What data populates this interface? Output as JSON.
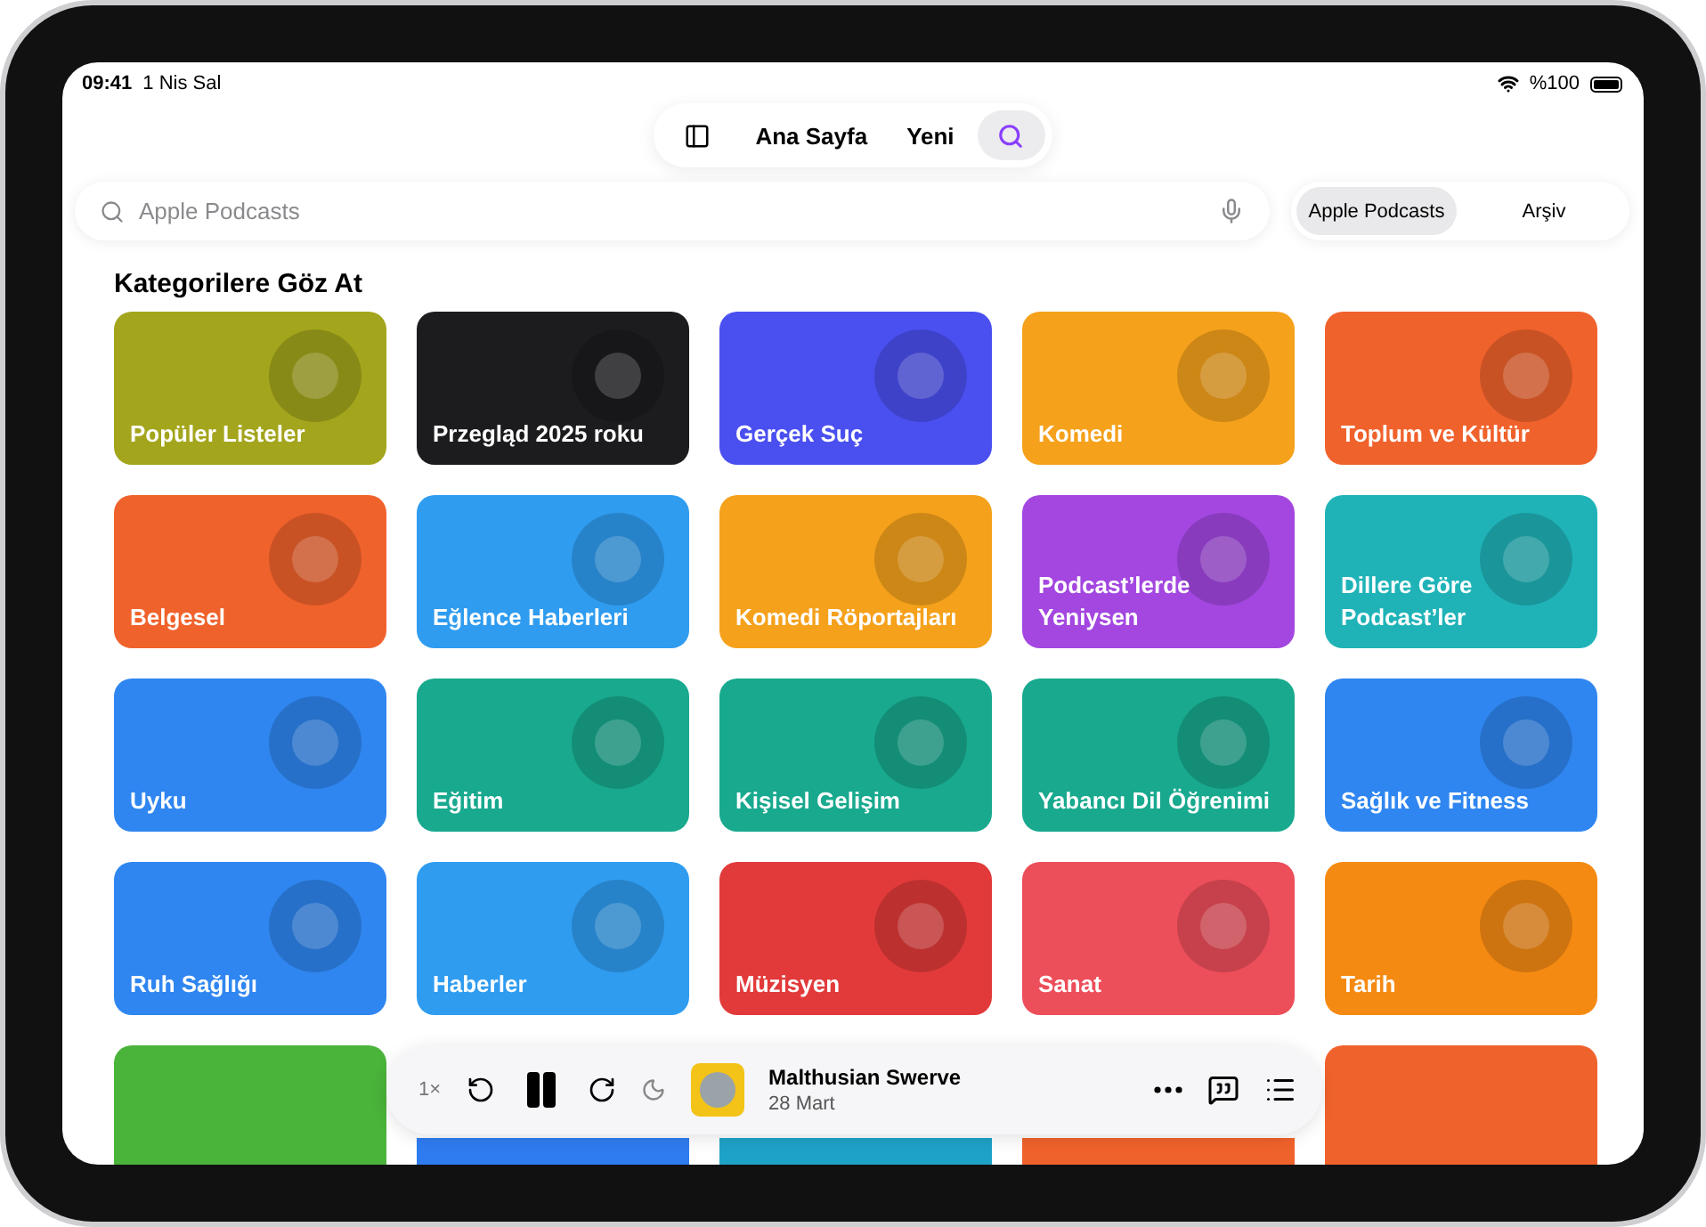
{
  "status_bar": {
    "time": "09:41",
    "date": "1 Nis Sal",
    "battery": "%100"
  },
  "nav": {
    "tabs": [
      {
        "label": "Ana Sayfa",
        "selected": false
      },
      {
        "label": "Yeni",
        "selected": false
      }
    ],
    "search_selected": true
  },
  "search": {
    "placeholder": "Apple Podcasts"
  },
  "scopes": [
    {
      "label": "Apple Podcasts",
      "selected": true
    },
    {
      "label": "Arşiv",
      "selected": false
    }
  ],
  "section_title": "Kategorilere Göz At",
  "categories": [
    {
      "label": "Popüler Listeler",
      "color": "#a3a51c"
    },
    {
      "label": "Przegląd 2025 roku",
      "color": "#1c1c1e"
    },
    {
      "label": "Gerçek Suç",
      "color": "#4a4ff0"
    },
    {
      "label": "Komedi",
      "color": "#f5a11b"
    },
    {
      "label": "Toplum ve Kültür",
      "color": "#f0622c"
    },
    {
      "label": "Belgesel",
      "color": "#f0622c"
    },
    {
      "label": "Eğlence Haberleri",
      "color": "#2f9cf0"
    },
    {
      "label": "Komedi Röportajları",
      "color": "#f5a11b"
    },
    {
      "label": "Podcast’lerde Yeniysen",
      "color": "#a347e0"
    },
    {
      "label": "Dillere Göre Podcast’ler",
      "color": "#1fb3b8"
    },
    {
      "label": "Uyku",
      "color": "#2f86f0"
    },
    {
      "label": "Eğitim",
      "color": "#18a98e"
    },
    {
      "label": "Kişisel Gelişim",
      "color": "#18a98e"
    },
    {
      "label": "Yabancı Dil Öğrenimi",
      "color": "#18a98e"
    },
    {
      "label": "Sağlık ve Fitness",
      "color": "#2f86f0"
    },
    {
      "label": "Ruh Sağlığı",
      "color": "#2f86f0"
    },
    {
      "label": "Haberler",
      "color": "#2f9cf0"
    },
    {
      "label": "Müzisyen",
      "color": "#e23a3a"
    },
    {
      "label": "Sanat",
      "color": "#ec4e5a"
    },
    {
      "label": "Tarih",
      "color": "#f58a12"
    },
    {
      "color": "#4ab33a"
    },
    {
      "color": "#2f7cf0"
    },
    {
      "color": "#1fa2c8"
    },
    {
      "color": "#f0622c"
    },
    {
      "color": "#f0622c"
    }
  ],
  "player": {
    "speed": "1×",
    "title": "Malthusian Swerve",
    "date": "28 Mart",
    "playing": true
  }
}
